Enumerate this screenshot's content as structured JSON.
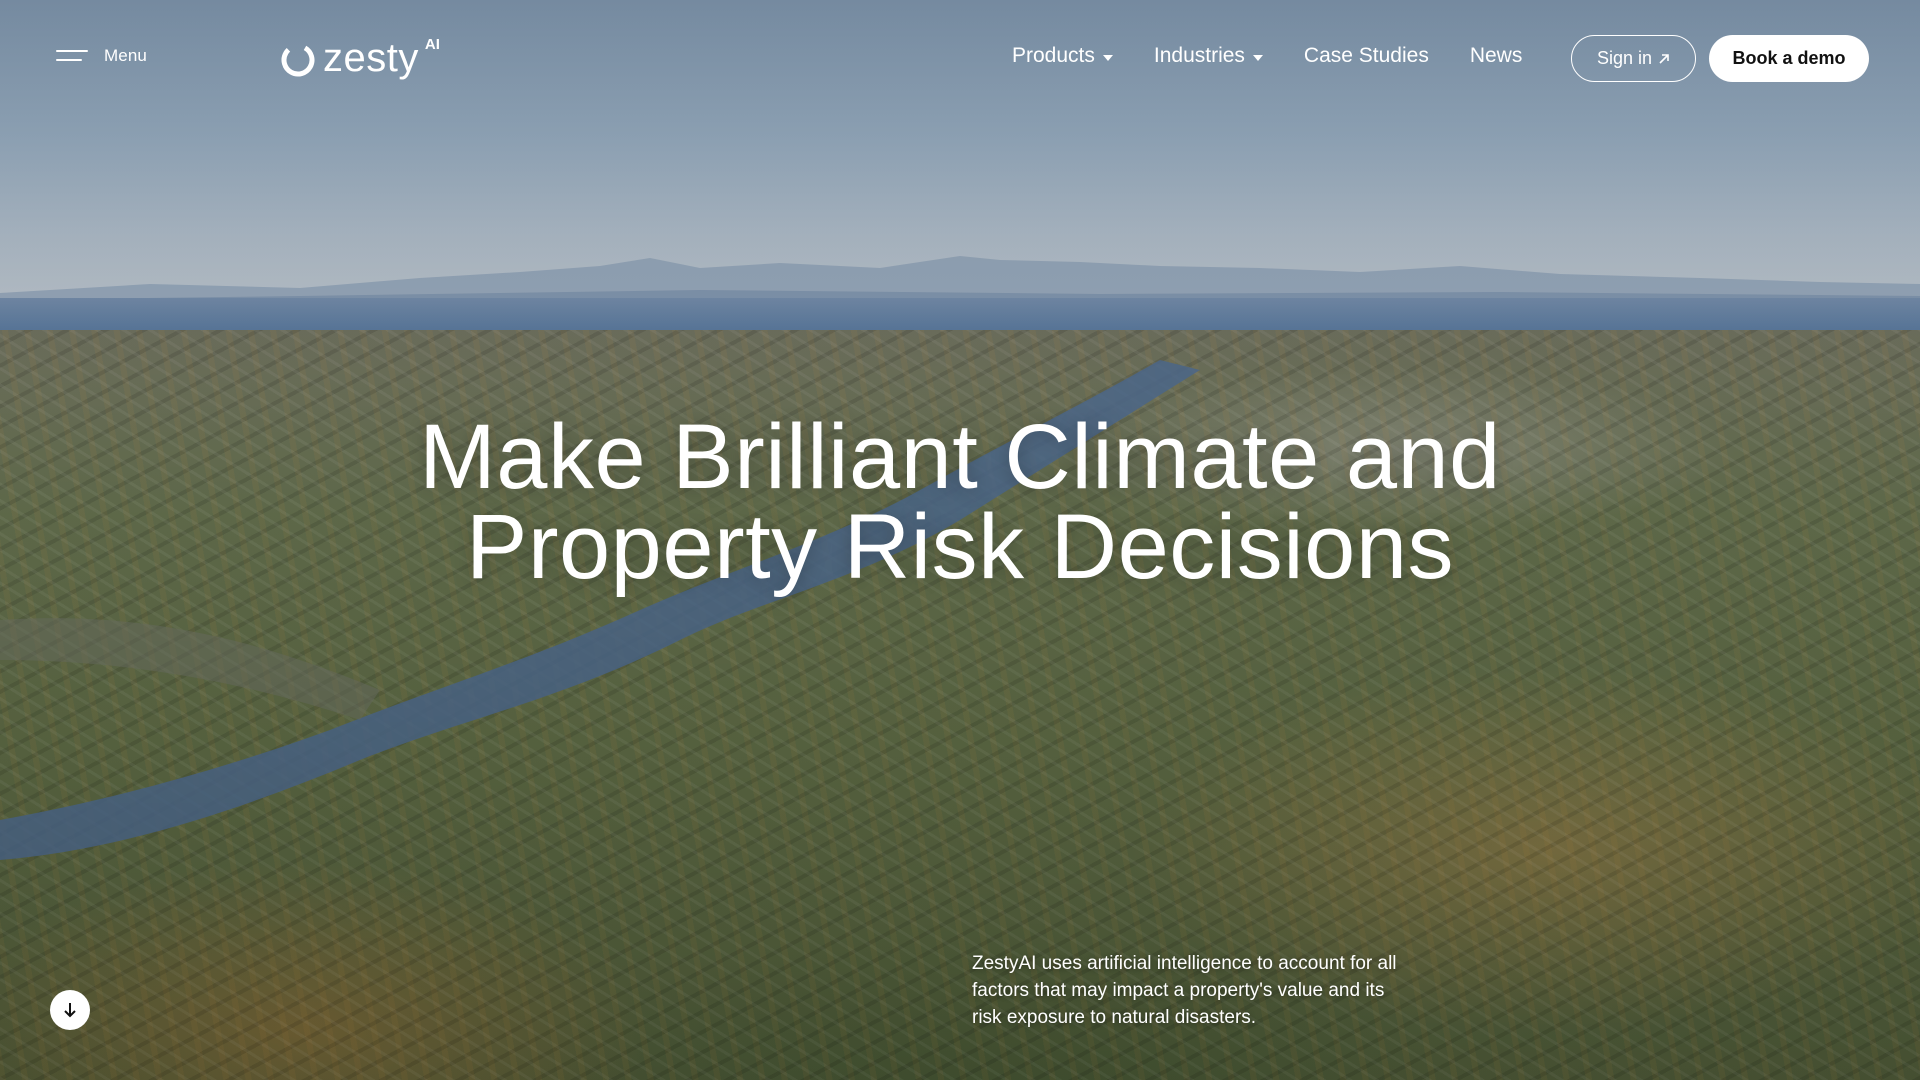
{
  "header": {
    "menu_label": "Menu",
    "brand": {
      "name": "zesty",
      "superscript": "AI"
    },
    "nav": [
      {
        "label": "Products",
        "has_dropdown": true
      },
      {
        "label": "Industries",
        "has_dropdown": true
      },
      {
        "label": "Case Studies",
        "has_dropdown": false
      },
      {
        "label": "News",
        "has_dropdown": false
      }
    ],
    "sign_in_label": "Sign in",
    "sign_in_icon": "arrow-up-right-icon",
    "demo_label": "Book a demo"
  },
  "hero": {
    "headline_line1": "Make Brilliant Climate and",
    "headline_line2": "Property Risk Decisions",
    "subcopy": "ZestyAI uses artificial intelligence to account for all factors that may impact a property's value and its risk exposure to natural disasters.",
    "scroll_icon": "arrow-down-icon"
  },
  "colors": {
    "text": "#ffffff",
    "demo_button_bg": "#ffffff",
    "demo_button_text": "#111111"
  }
}
